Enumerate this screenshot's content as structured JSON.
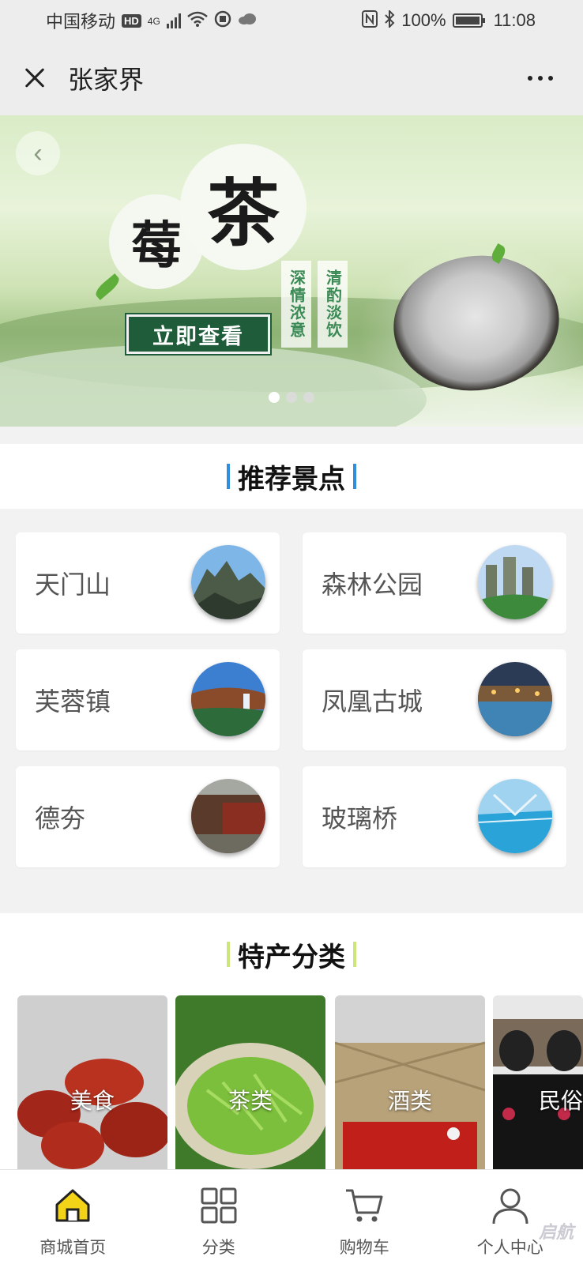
{
  "status_bar": {
    "carrier": "中国移动",
    "hd": "HD",
    "network": "4G",
    "battery": "100%",
    "time": "11:08"
  },
  "header": {
    "title": "张家界",
    "close_icon": "close-icon",
    "more_icon": "more-dots-icon"
  },
  "banner": {
    "char_small": "莓",
    "char_big": "茶",
    "tag_1": "深情浓意",
    "tag_2": "清酌淡饮",
    "cta": "立即查看",
    "slides": 3,
    "active_slide": 1
  },
  "recommended": {
    "title": "推荐景点",
    "items": [
      {
        "label": "天门山"
      },
      {
        "label": "森林公园"
      },
      {
        "label": "芙蓉镇"
      },
      {
        "label": "凤凰古城"
      },
      {
        "label": "德夯"
      },
      {
        "label": "玻璃桥"
      }
    ]
  },
  "specialty": {
    "title": "特产分类",
    "items": [
      {
        "label": "美食"
      },
      {
        "label": "茶类"
      },
      {
        "label": "酒类"
      },
      {
        "label": "民俗"
      }
    ]
  },
  "tabbar": {
    "items": [
      {
        "label": "商城首页",
        "icon": "home-icon"
      },
      {
        "label": "分类",
        "icon": "grid-icon"
      },
      {
        "label": "购物车",
        "icon": "cart-icon"
      },
      {
        "label": "个人中心",
        "icon": "user-icon"
      }
    ]
  },
  "watermark": "启航",
  "colors": {
    "accent_blue": "#2f8fde",
    "accent_green": "#cde67a",
    "home_icon_yellow": "#f2d318",
    "cta_green": "#1f5c3a"
  }
}
